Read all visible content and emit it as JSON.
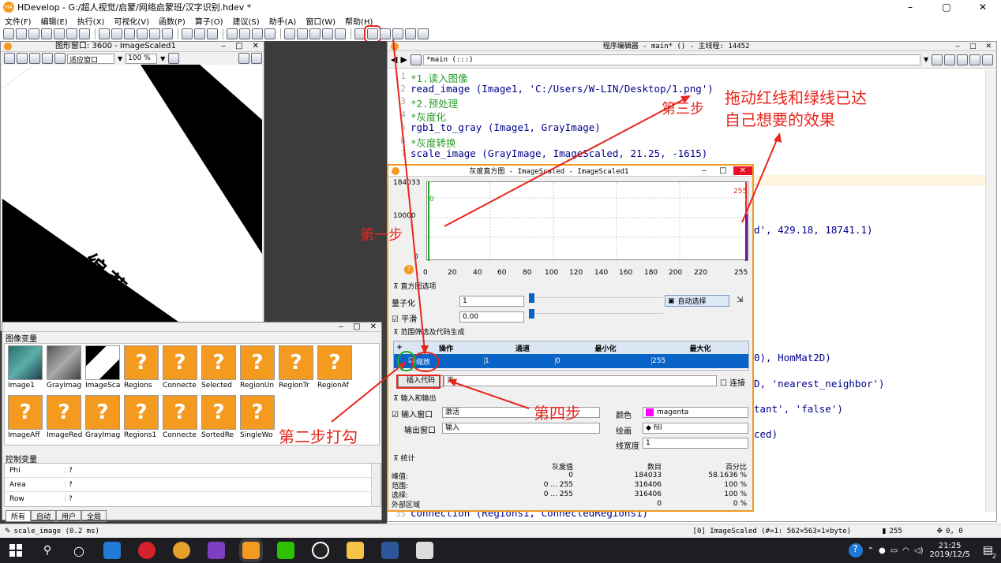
{
  "app": {
    "title": "HDevelop - G:/超人视觉/启蒙/网络启蒙班/汉字识别.hdev *",
    "minimize": "–",
    "maximize": "▢",
    "close": "✕"
  },
  "menu": [
    "文件(F)",
    "编辑(E)",
    "执行(X)",
    "可视化(V)",
    "函数(P)",
    "算子(O)",
    "建议(S)",
    "助手(A)",
    "窗口(W)",
    "帮助(H)"
  ],
  "graphics_window": {
    "title": "图形窗口: 3600 - ImageScaled1",
    "zoom_mode": "适应窗口",
    "zoom_pct": "100 %",
    "image_text": "编著：罗超"
  },
  "image_vars": {
    "title": "图像变量",
    "row1": [
      "Image1",
      "GrayImag",
      "ImageSca",
      "Regions",
      "Connecte",
      "Selected",
      "RegionUn",
      "RegionTr",
      "RegionAf"
    ],
    "row2": [
      "ImageAff",
      "ImageRed",
      "GrayImag",
      "Regions1",
      "Connecte",
      "SortedRe",
      "SingleWo"
    ],
    "unknown_mark": "?"
  },
  "control_vars": {
    "title": "控制变量",
    "rows": [
      {
        "name": "Phi",
        "value": "?"
      },
      {
        "name": "Area",
        "value": "?"
      },
      {
        "name": "Row",
        "value": "?"
      }
    ]
  },
  "var_tabs": [
    "所有",
    "自动",
    "用户",
    "全局"
  ],
  "editor": {
    "title": "程序编辑器 - main* () - 主线程: 14452",
    "proc": "*main (:::)",
    "lines": [
      {
        "n": "1",
        "t": "*1.读入图像",
        "c": true
      },
      {
        "n": "2",
        "t": "read_image (Image1, 'C:/Users/W-LIN/Desktop/1.png')",
        "c": false
      },
      {
        "n": "3",
        "t": "*2.预处理",
        "c": true
      },
      {
        "n": "4",
        "t": "*灰度化",
        "c": true
      },
      {
        "n": "5",
        "t": "rgb1_to_gray (Image1, GrayImage)",
        "c": false
      },
      {
        "n": "6",
        "t": "*灰度转换",
        "c": true
      },
      {
        "n": "7",
        "t": "scale_image (GrayImage, ImageScaled, 21.25, -1615)",
        "c": false
      }
    ],
    "partial": [
      "d', 429.18, 18741.1)",
      "0), HomMat2D)",
      "D, 'nearest_neighbor')",
      "tant', 'false')",
      "ced)"
    ],
    "last_line": "connection (Regions1, ConnectedRegions1)",
    "last_ln": "35"
  },
  "histogram": {
    "title": "灰度直方图 - ImageScaled - ImageScaled1",
    "y_max": "184033",
    "y_mid": "10000",
    "y_zero": "0",
    "green_label": "0",
    "red_label": "255",
    "x_ticks": [
      "0",
      "20",
      "40",
      "60",
      "80",
      "100",
      "120",
      "140",
      "160",
      "180",
      "200",
      "220",
      "255"
    ],
    "options_title": "直方图选项",
    "quantize_label": "量子化",
    "quantize_value": "1",
    "smooth_label": "平滑",
    "smooth_value": "0.00",
    "auto_select": "自动选择",
    "range_title": "范围筛选及代码生成",
    "cols": [
      "操作",
      "通道",
      "最小化",
      "最大化"
    ],
    "row": {
      "op": "缩放",
      "ch": "1",
      "min": "0",
      "max": "255"
    },
    "insert_code": "插入代码",
    "insert_value": "无",
    "connect": "连接",
    "io_title": "输入和输出",
    "input_win": "输入窗口",
    "input_val": "激活",
    "output_win": "输出窗口",
    "output_val": "输入",
    "color_label": "颜色",
    "color_val": "magenta",
    "draw_label": "绘画",
    "draw_val": "fill",
    "lw_label": "线宽度",
    "lw_val": "1",
    "stats_title": "统计",
    "stat_cols": [
      "灰度值",
      "数目",
      "百分比"
    ],
    "stats": [
      {
        "k": "峰值:",
        "g": "0",
        "n": "184033",
        "p": "58.1636 %"
      },
      {
        "k": "范围:",
        "g": "0 ... 255",
        "n": "316406",
        "p": "100 %"
      },
      {
        "k": "选择:",
        "g": "0 ... 255",
        "n": "316406",
        "p": "100 %"
      },
      {
        "k": "外部区域",
        "g": "",
        "n": "0",
        "p": "0 %"
      }
    ]
  },
  "status": {
    "left": "scale_image (0.2 ms)",
    "image": "[0] ImageScaled (#=1: 562×563×1×byte)",
    "gray": "255",
    "pos": "0, 0"
  },
  "annotations": {
    "step1": "第一步",
    "step2": "第二步打勾",
    "step3": "第三步",
    "step3_note": "拖动红线和绿线已达\n自己想要的效果",
    "step4": "第四步"
  },
  "taskbar": {
    "time": "21:25",
    "date": "2019/12/5",
    "badge": "2"
  },
  "colors": {
    "accent": "#0a64c8",
    "orange": "#f39a1f",
    "red": "#e8261d",
    "green": "#1fa81f"
  }
}
